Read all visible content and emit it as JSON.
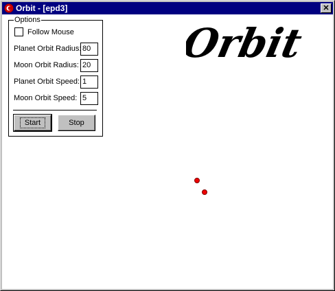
{
  "window": {
    "title": "Orbit - [epd3]",
    "close_symbol": "✕"
  },
  "options": {
    "group_label": "Options",
    "follow_mouse_label": "Follow Mouse",
    "follow_mouse_checked": false,
    "fields": [
      {
        "label": "Planet Orbit Radius:",
        "value": "80"
      },
      {
        "label": "Moon Orbit Radius:",
        "value": "20"
      },
      {
        "label": "Planet Orbit Speed:",
        "value": "1"
      },
      {
        "label": "Moon Orbit Speed:",
        "value": "5"
      }
    ],
    "start_label": "Start",
    "stop_label": "Stop"
  },
  "logo": {
    "text": "Orbit"
  },
  "colors": {
    "title_bar": "#000080",
    "planet": "#ee0000",
    "moon": "#ee0000"
  }
}
